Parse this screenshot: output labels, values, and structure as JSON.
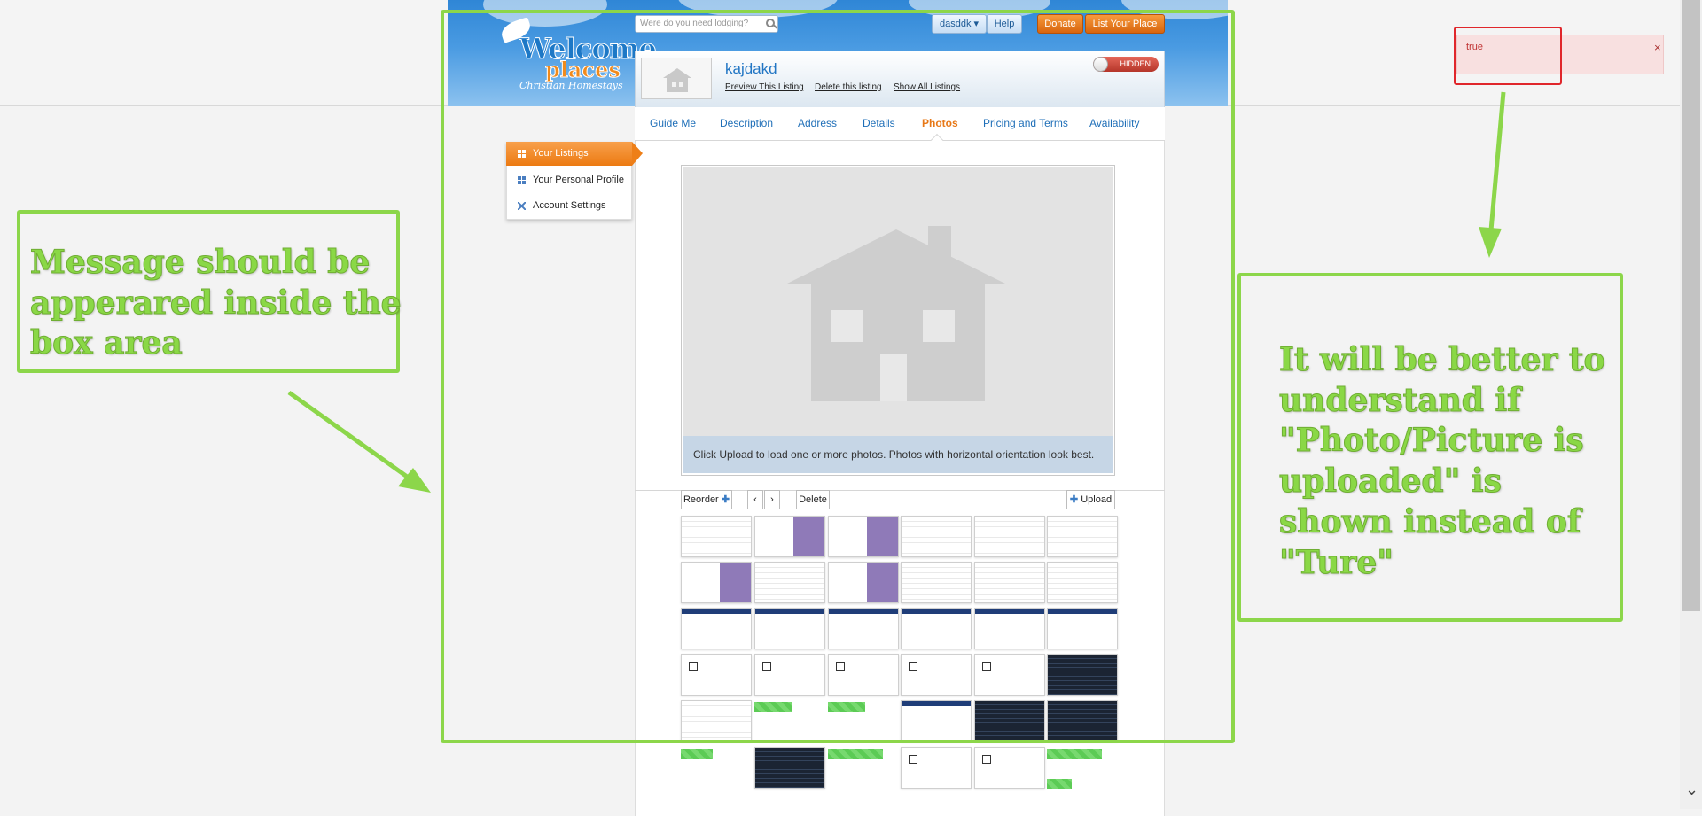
{
  "header": {
    "search_placeholder": "Were do you need lodging?",
    "user_menu_label": "dasddk ▾",
    "help_label": "Help",
    "donate_label": "Donate",
    "list_place_label": "List Your Place",
    "logo": {
      "line1": "Welcome",
      "line2": "places",
      "line3": "Christian Homestays"
    }
  },
  "listing": {
    "title": "kajdakd",
    "links": [
      "Preview This Listing",
      "Delete this listing",
      "Show All Listings"
    ],
    "visibility_label": "HIDDEN"
  },
  "tabs": [
    "Guide Me",
    "Description",
    "Address",
    "Details",
    "Photos",
    "Pricing and Terms",
    "Availability"
  ],
  "active_tab": "Photos",
  "sidebar": {
    "items": [
      {
        "label": "Your Listings",
        "active": true
      },
      {
        "label": "Your Personal Profile",
        "active": false
      },
      {
        "label": "Account Settings",
        "active": false
      }
    ]
  },
  "photos": {
    "hint": "Click Upload to load one or more photos. Photos with horizontal orientation look best.",
    "toolbar": {
      "reorder_label": "Reorder",
      "prev_label": "‹",
      "next_label": "›",
      "delete_label": "Delete",
      "upload_label": "Upload"
    }
  },
  "alert": {
    "message": "true",
    "close_label": "×"
  },
  "annotations": {
    "left_text": "Message should be apperared inside the box area",
    "right_text": "It will be better to understand if \"Photo/Picture is uploaded\" is shown instead of \"Ture\""
  },
  "colors": {
    "accent_blue": "#2276c4",
    "accent_orange": "#ec7a12",
    "annotation_green": "#8cd64a",
    "alert_red": "#c03333"
  }
}
